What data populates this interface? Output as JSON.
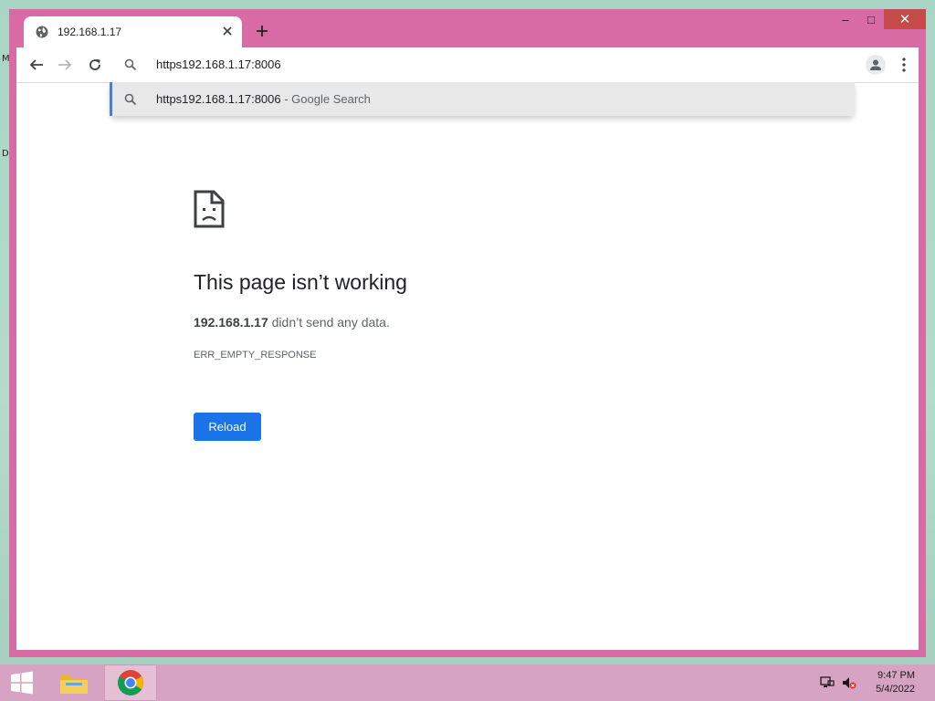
{
  "desktop": {
    "fragments": [
      "M",
      "D"
    ]
  },
  "browser": {
    "tab": {
      "title": "192.168.1.17",
      "favicon": "globe-icon"
    },
    "new_tab_label": "+",
    "window_controls": {
      "minimize": "–",
      "maximize": "□",
      "close": "✕"
    },
    "omnibox": {
      "value": "https192.168.1.17:8006"
    },
    "suggestion": {
      "text": "https192.168.1.17:8006",
      "suffix": " - Google Search"
    },
    "accent_color": "#1a73e8",
    "frame_color": "#d86ba4"
  },
  "error_page": {
    "title": "This page isn’t working",
    "host": "192.168.1.17",
    "message": " didn’t send any data.",
    "code": "ERR_EMPTY_RESPONSE",
    "reload_label": "Reload"
  },
  "taskbar": {
    "items": [
      "start-icon",
      "file-explorer-icon",
      "chrome-icon"
    ],
    "tray": [
      "network-icon",
      "volume-muted-icon"
    ],
    "time": "9:47 PM",
    "date": "5/4/2022"
  }
}
